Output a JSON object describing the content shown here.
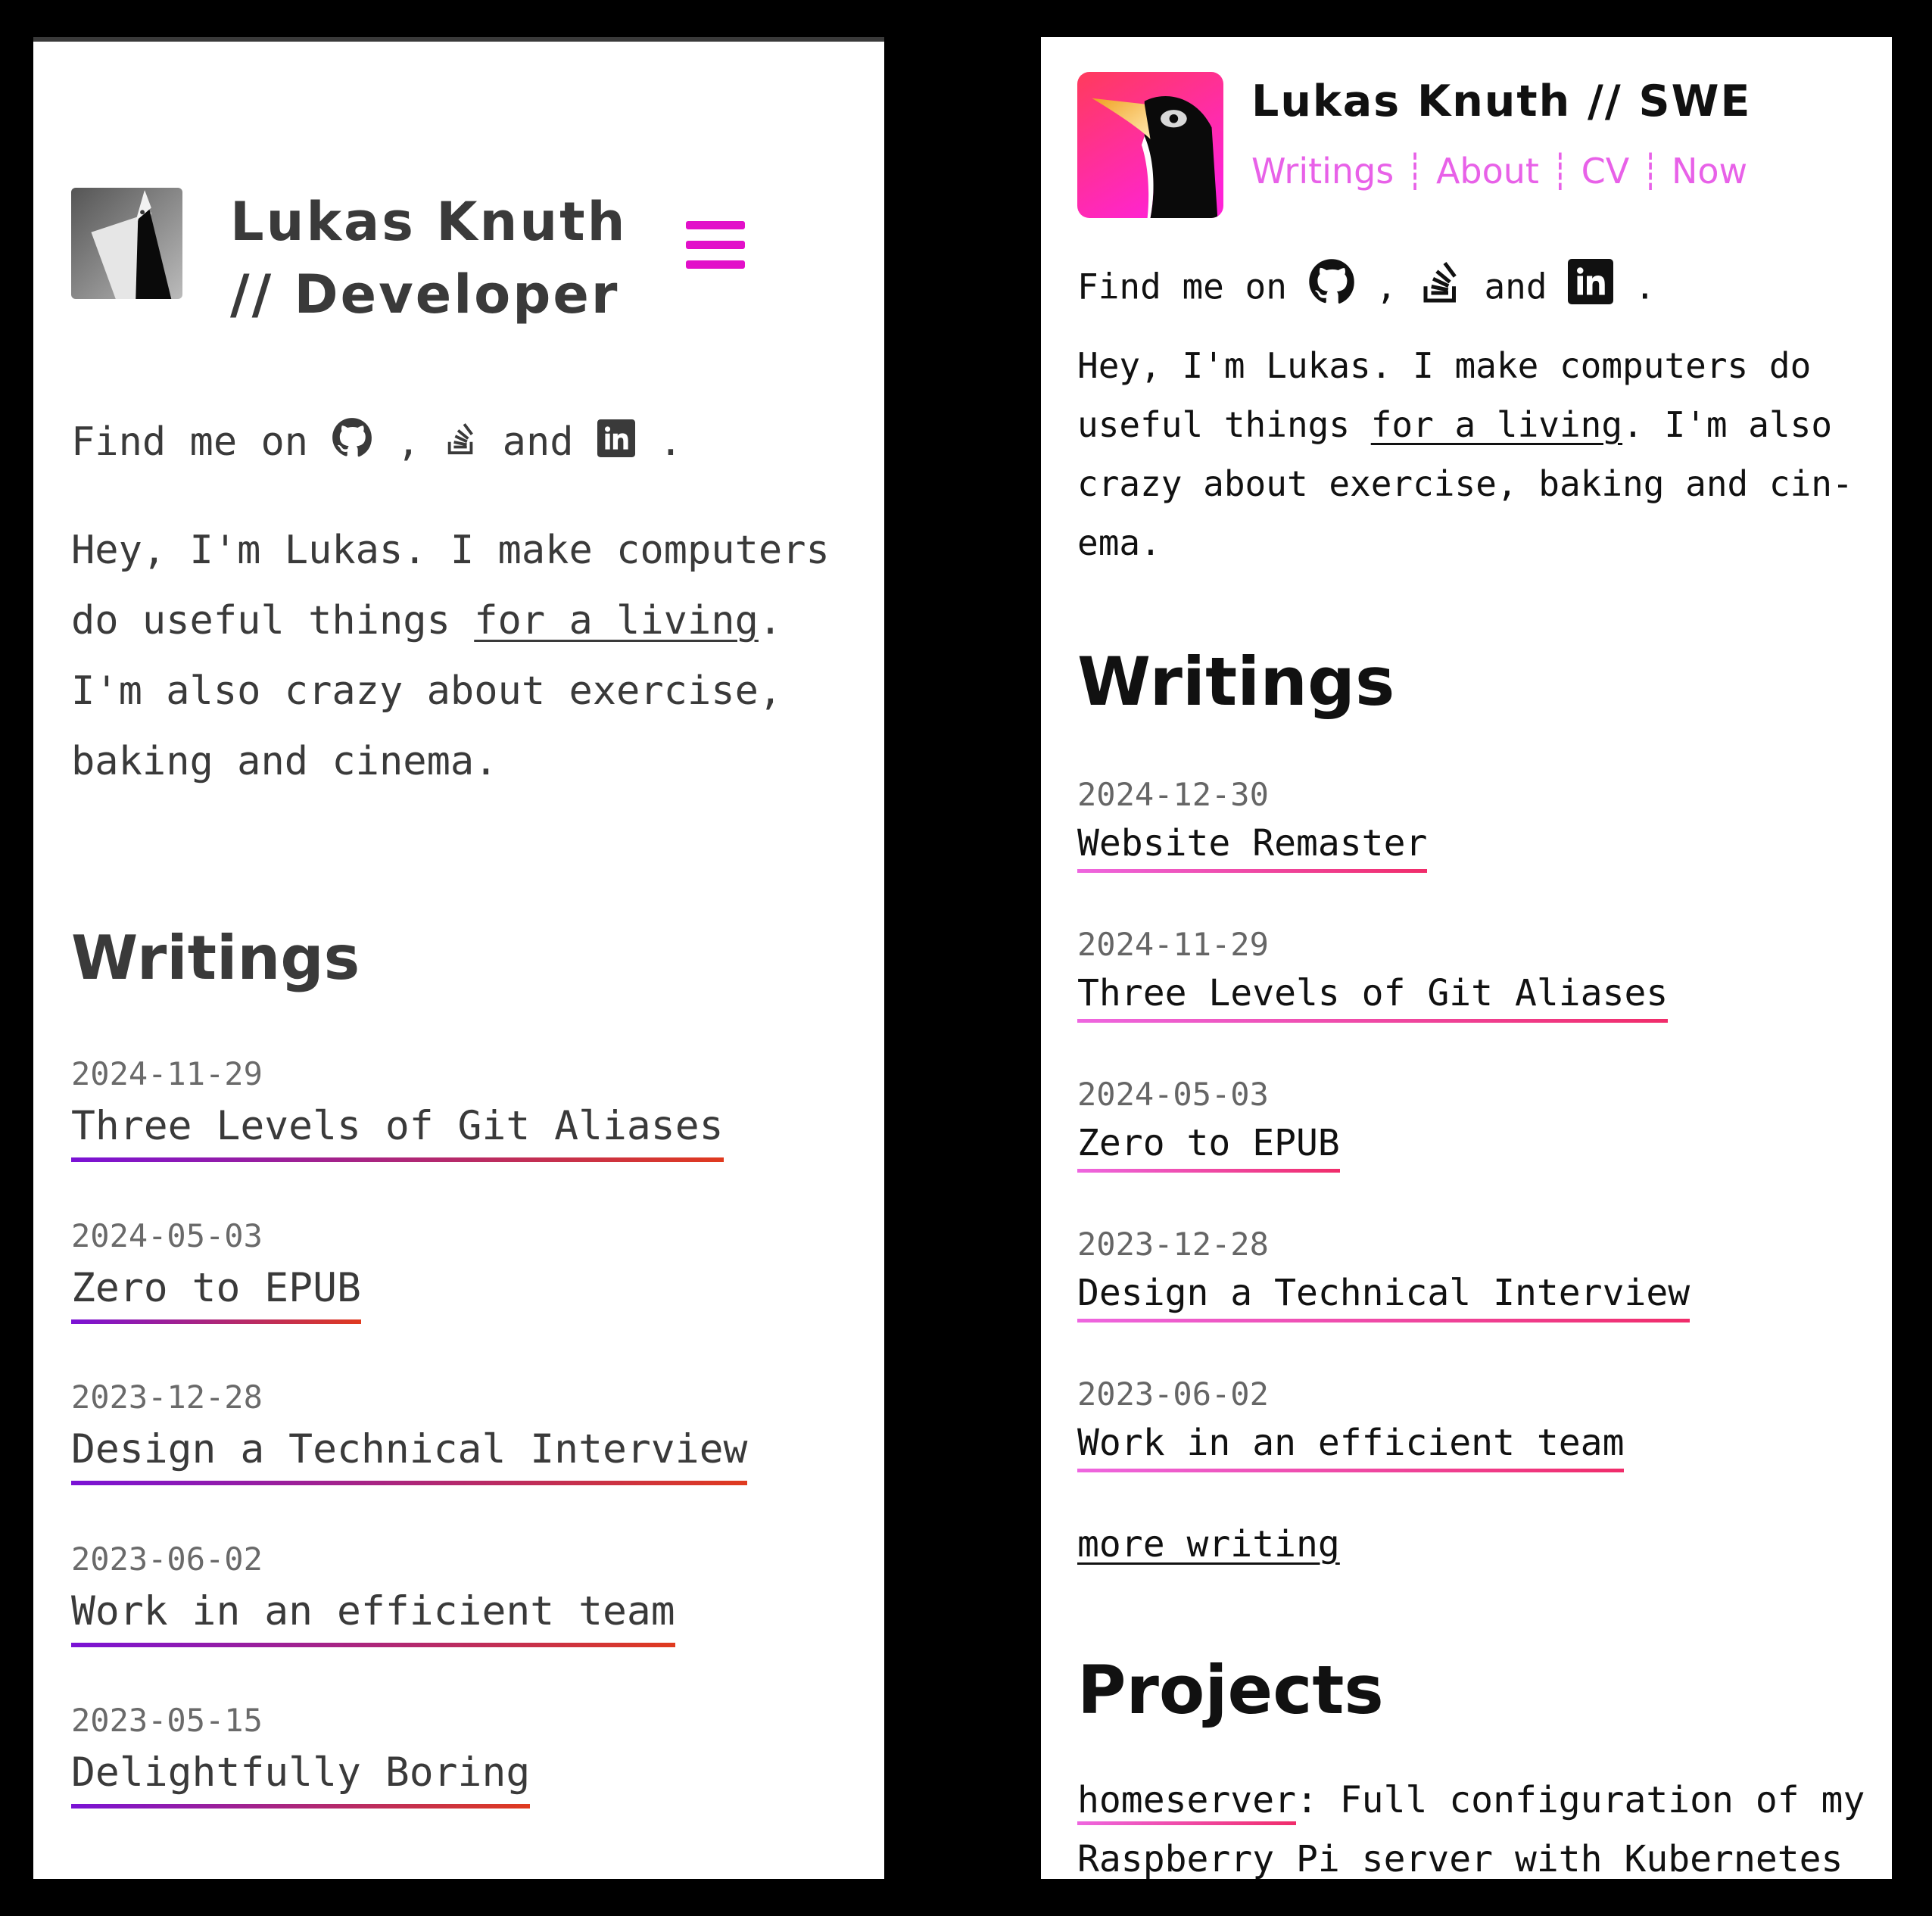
{
  "colors": {
    "accent_left": "#e210c9",
    "accent_right": "#e861e8",
    "underline_left": [
      "#7a12d6",
      "#e03a1e"
    ],
    "underline_right": [
      "#ee66e0",
      "#f02c6a"
    ]
  },
  "left": {
    "title_line1": "Lukas Knuth",
    "title_line2": "// Developer",
    "menu_icon": "hamburger-menu-icon",
    "social": {
      "prefix": "Find me on",
      "comma": ",",
      "and": "and",
      "period": "."
    },
    "intro": {
      "before": "Hey, I'm Lukas. I make computers do useful things ",
      "link": "for a living",
      "after": ". I'm also crazy about exercise, baking and cinema."
    },
    "writings_heading": "Writings",
    "writings": [
      {
        "date": "2024-11-29",
        "title": "Three Levels of Git Aliases"
      },
      {
        "date": "2024-05-03",
        "title": "Zero to EPUB"
      },
      {
        "date": "2023-12-28",
        "title": "Design a Technical Interview"
      },
      {
        "date": "2023-06-02",
        "title": "Work in an efficient team"
      },
      {
        "date": "2023-05-15",
        "title": "Delightfully Boring"
      }
    ]
  },
  "right": {
    "title": "Lukas Knuth // SWE",
    "nav": [
      "Writings",
      "About",
      "CV",
      "Now"
    ],
    "nav_sep": "┊",
    "social": {
      "prefix": "Find me on",
      "comma": ",",
      "and": "and",
      "period": "."
    },
    "intro": {
      "before": "Hey, I'm Lukas. I make computers do useful things ",
      "link": "for a living",
      "after": ". I'm also crazy about exercise, baking and cin­ema."
    },
    "writings_heading": "Writings",
    "writings": [
      {
        "date": "2024-12-30",
        "title": "Website Remaster"
      },
      {
        "date": "2024-11-29",
        "title": "Three Levels of Git Aliases"
      },
      {
        "date": "2024-05-03",
        "title": "Zero to EPUB"
      },
      {
        "date": "2023-12-28",
        "title": "Design a Technical Interview"
      },
      {
        "date": "2023-06-02",
        "title": "Work in an efficient team"
      }
    ],
    "more_writing": "more writing",
    "projects_heading": "Projects",
    "project": {
      "name": "homeserver",
      "desc": ": Full configuration of my Raspberry Pi server with Kubernetes via"
    }
  }
}
